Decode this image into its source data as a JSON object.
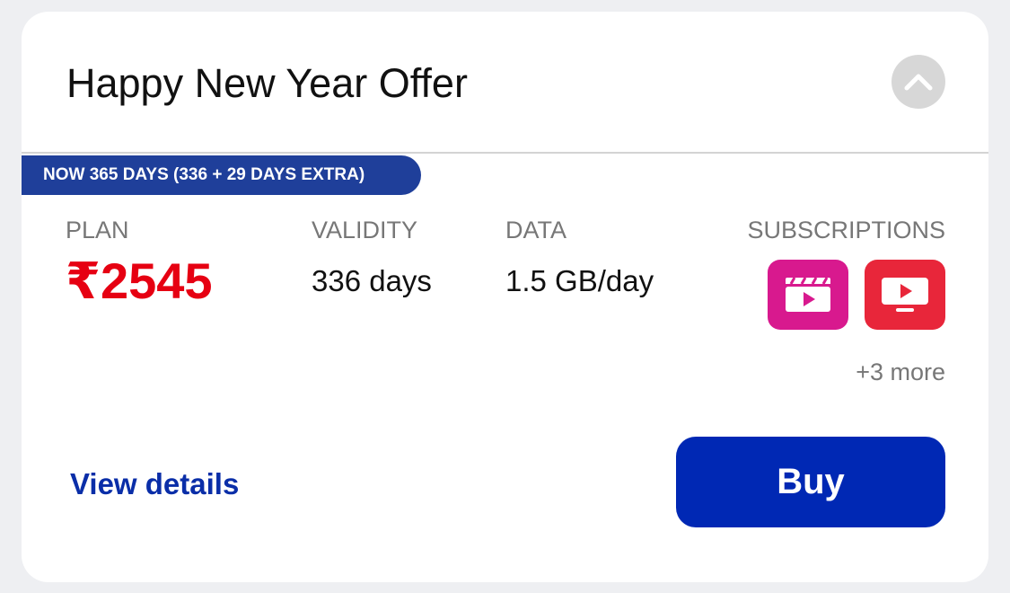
{
  "offer": {
    "title": "Happy New Year Offer",
    "badge": "NOW 365 DAYS (336 + 29 DAYS EXTRA)"
  },
  "columns": {
    "plan_label": "PLAN",
    "validity_label": "VALIDITY",
    "data_label": "DATA",
    "subscriptions_label": "SUBSCRIPTIONS"
  },
  "values": {
    "price": "₹2545",
    "validity": "336 days",
    "data": "1.5 GB/day"
  },
  "subscriptions": {
    "icons": [
      "cinema-app-icon",
      "tv-app-icon"
    ],
    "more": "+3 more"
  },
  "actions": {
    "view_details": "View details",
    "buy": "Buy"
  },
  "colors": {
    "price": "#e60012",
    "badge": "#1f3f9a",
    "buy_button": "#0028b4",
    "link": "#0a2ea8",
    "cinema_icon_bg": "#d8198e",
    "tv_icon_bg": "#e8263a"
  }
}
